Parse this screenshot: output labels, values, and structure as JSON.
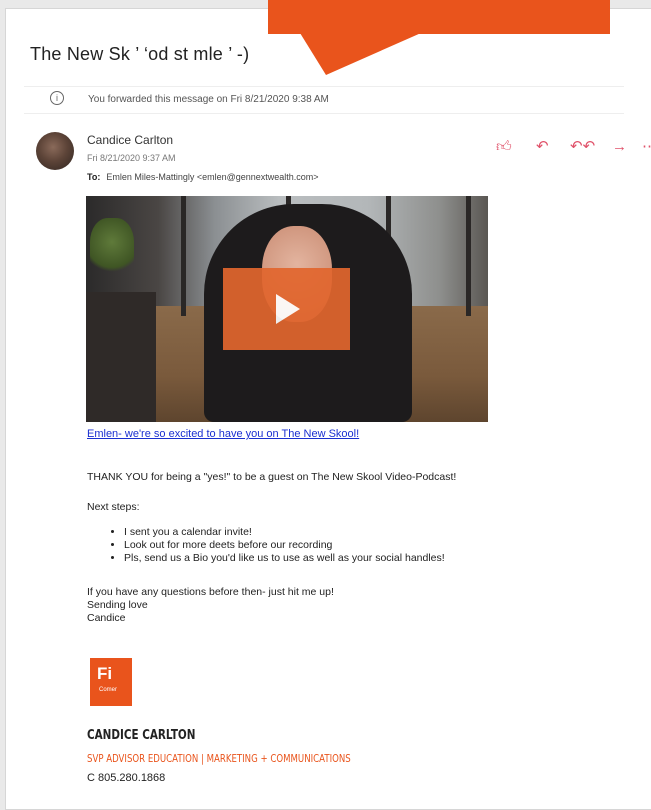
{
  "email": {
    "subject": "The New Sk ’ ‘od st mle ’ -)",
    "forward_notice": "You forwarded this message on Fri 8/21/2020 9:38 AM",
    "sender_name": "Candice Carlton",
    "sent_date": "Fri 8/21/2020 9:37 AM",
    "to_label": "To:",
    "to_value": "Emlen Miles-Mattingly <emlen@gennextwealth.com>",
    "video_link": "Emlen- we're so excited to have you on The New Skool!",
    "thanks": "THANK YOU for being a \"yes!\" to be a guest on The New Skool Video-Podcast!",
    "next_steps": "Next steps:",
    "steps": [
      "I sent you a calendar invite!",
      "Look out for more deets before our recording",
      "Pls, send us a Bio you'd like us to use as well as your social handles!"
    ],
    "closing": "If you have any questions before then- just hit me up!",
    "sign_off": "Sending love",
    "sign_name": "Candice"
  },
  "signature": {
    "logo_text": "Fi",
    "logo_subtext": "Comer",
    "name": "CANDICE CARLTON",
    "title": "SVP ADVISOR EDUCATION | MARKETING + COMMUNICATIONS",
    "phone": "C 805.280.1868"
  },
  "icons": {
    "info": "info-icon",
    "actions": [
      "like-icon",
      "reply-icon",
      "reply-all-icon",
      "forward-icon",
      "more-icon"
    ]
  },
  "colors": {
    "accent": "#e9541c",
    "link": "#1a2fd0",
    "action_icons": "#e0526a"
  }
}
